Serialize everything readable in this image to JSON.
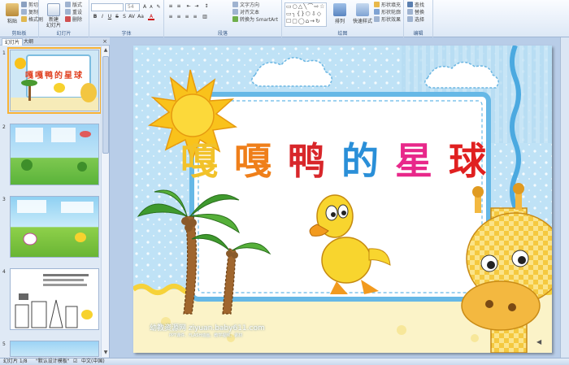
{
  "ribbon": {
    "clipboard": {
      "label": "剪贴板",
      "paste": "粘贴",
      "cut": "剪切",
      "copy": "复制",
      "format_painter": "格式刷"
    },
    "slides": {
      "label": "幻灯片",
      "new_slide": "新建\n幻灯片",
      "layout": "版式",
      "reset": "重设",
      "delete": "删除"
    },
    "font": {
      "label": "字体",
      "size": "54"
    },
    "paragraph": {
      "label": "段落",
      "text_direction": "文字方向",
      "align_text": "对齐文本",
      "smartart": "转换为 SmartArt"
    },
    "drawing": {
      "label": "绘图",
      "arrange": "排列",
      "quick_styles": "快速样式",
      "shape_fill": "形状填充",
      "shape_outline": "形状轮廓",
      "shape_effects": "形状效果"
    },
    "editing": {
      "label": "编辑",
      "find": "查找",
      "replace": "替换",
      "select": "选择"
    }
  },
  "pane": {
    "tab_slides": "幻灯片",
    "tab_outline": "大纲",
    "close": "×",
    "thumbs": [
      {
        "num": "1",
        "caption": "嘎嘎鸭的星球"
      },
      {
        "num": "2"
      },
      {
        "num": "3"
      },
      {
        "num": "4"
      },
      {
        "num": "5"
      }
    ]
  },
  "slide": {
    "title_chars": [
      "嘎",
      "嘎",
      "鸭",
      "的",
      "星",
      "球"
    ],
    "title_colors": [
      "#f2c22a",
      "#ef7f1a",
      "#d8262a",
      "#2a8fd8",
      "#e8288a",
      "#e02020"
    ],
    "watermark": "幼教资源网 ziyuan.baby611.com",
    "watermark_sub": "PPT课件、FLASH动画、教学视频、素材"
  },
  "status": {
    "slide_info": "幻灯片 1/8",
    "theme": "\"默认设计模板\"",
    "language": "中文(中国)"
  }
}
